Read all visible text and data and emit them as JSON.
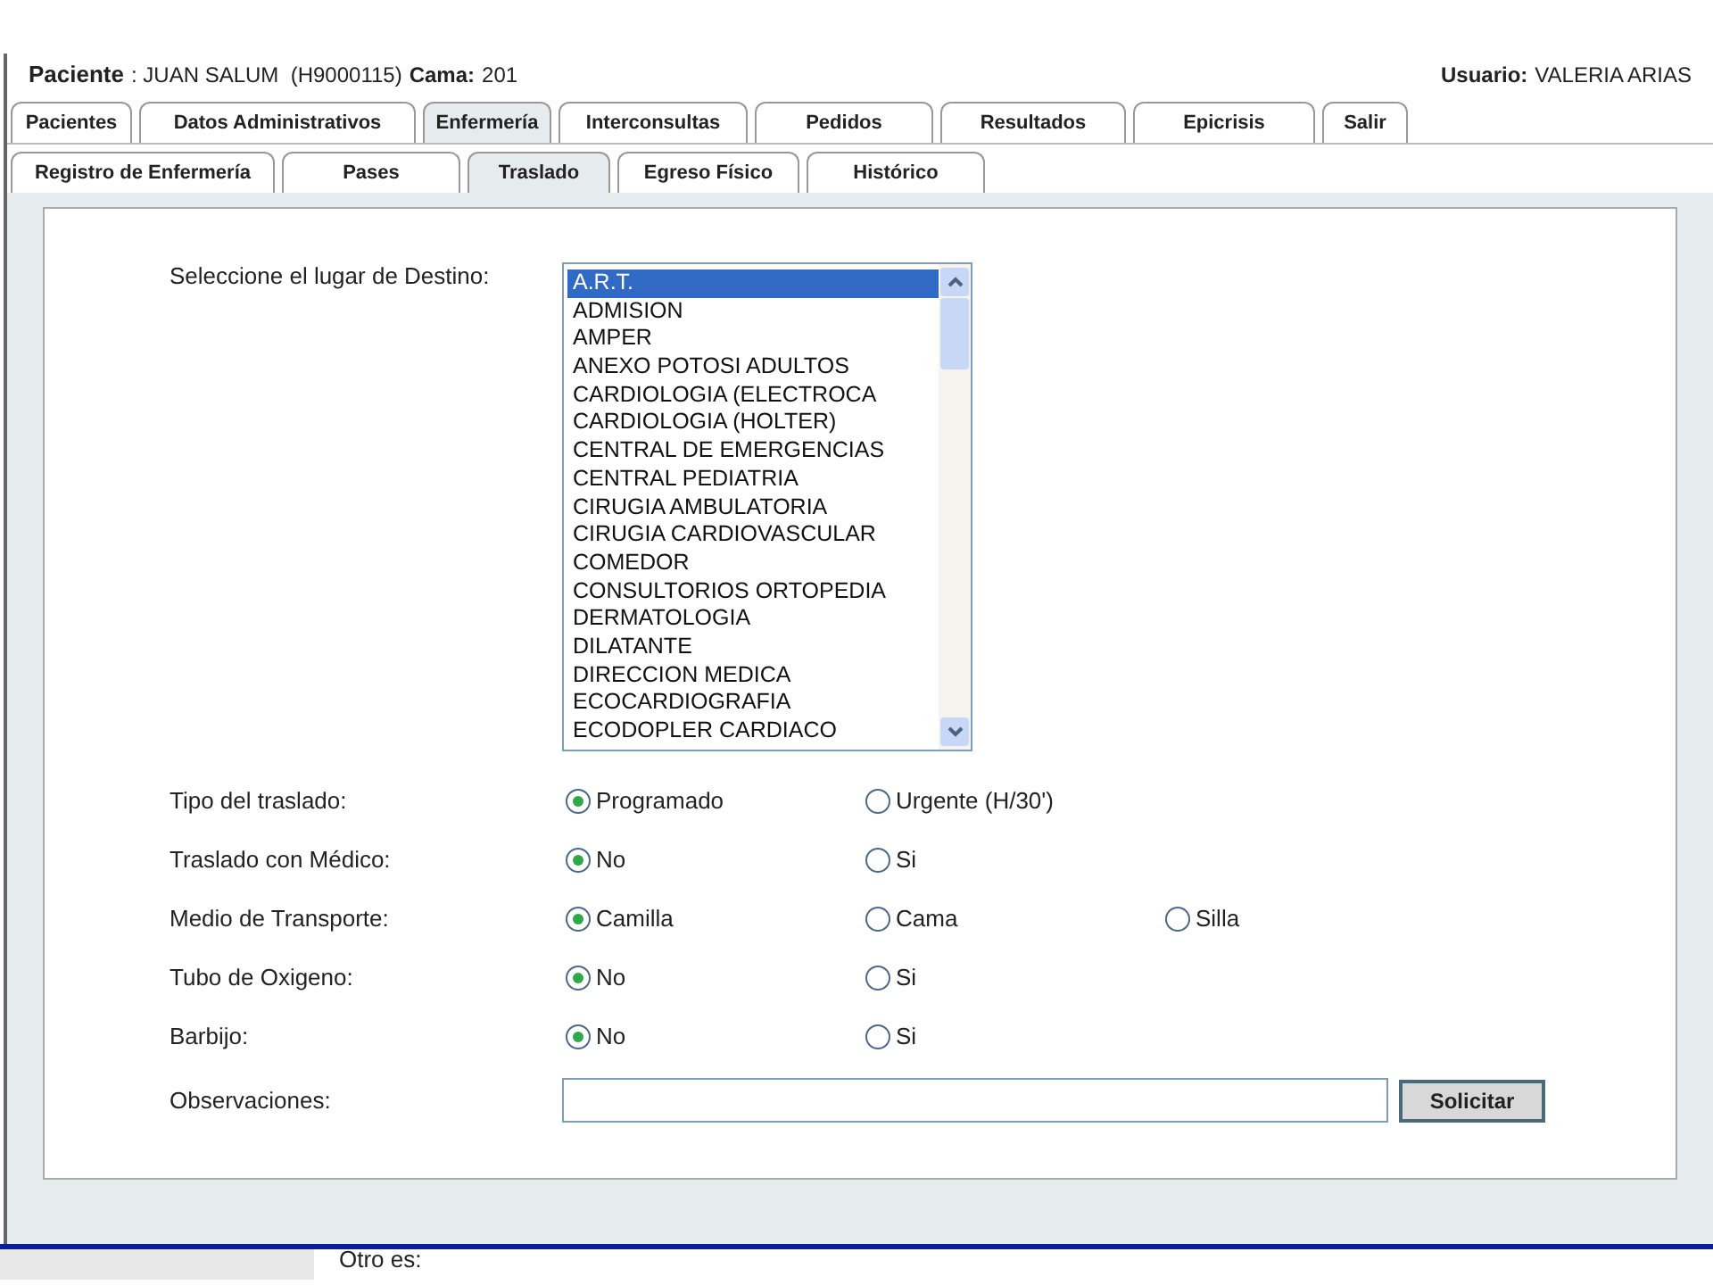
{
  "header": {
    "patient_label": "Paciente",
    "patient_value": ": JUAN SALUM  (H9000115)",
    "bed_label": "Cama:",
    "bed_value": "201",
    "user_label": "Usuario:",
    "user_value": "VALERIA ARIAS"
  },
  "main_tabs": [
    {
      "label": "Pacientes",
      "selected": false
    },
    {
      "label": "Datos Administrativos",
      "selected": false
    },
    {
      "label": "Enfermería",
      "selected": true
    },
    {
      "label": "Interconsultas",
      "selected": false
    },
    {
      "label": "Pedidos",
      "selected": false
    },
    {
      "label": "Resultados",
      "selected": false
    },
    {
      "label": "Epicrisis",
      "selected": false
    },
    {
      "label": "Salir",
      "selected": false
    }
  ],
  "sub_tabs": [
    {
      "label": "Registro de Enfermería",
      "selected": false
    },
    {
      "label": "Pases",
      "selected": false
    },
    {
      "label": "Traslado",
      "selected": true
    },
    {
      "label": "Egreso Físico",
      "selected": false
    },
    {
      "label": "Histórico",
      "selected": false
    }
  ],
  "destination": {
    "label": "Seleccione el lugar de Destino:",
    "options": [
      {
        "label": "A.R.T.",
        "selected": true
      },
      {
        "label": "ADMISION",
        "selected": false
      },
      {
        "label": "AMPER",
        "selected": false
      },
      {
        "label": "ANEXO POTOSI ADULTOS",
        "selected": false
      },
      {
        "label": "CARDIOLOGIA (ELECTROCA",
        "selected": false
      },
      {
        "label": "CARDIOLOGIA (HOLTER)",
        "selected": false
      },
      {
        "label": "CENTRAL DE EMERGENCIAS",
        "selected": false
      },
      {
        "label": "CENTRAL PEDIATRIA",
        "selected": false
      },
      {
        "label": "CIRUGIA AMBULATORIA",
        "selected": false
      },
      {
        "label": "CIRUGIA CARDIOVASCULAR",
        "selected": false
      },
      {
        "label": "COMEDOR",
        "selected": false
      },
      {
        "label": "CONSULTORIOS ORTOPEDIA",
        "selected": false
      },
      {
        "label": "DERMATOLOGIA",
        "selected": false
      },
      {
        "label": "DILATANTE",
        "selected": false
      },
      {
        "label": "DIRECCION MEDICA",
        "selected": false
      },
      {
        "label": "ECOCARDIOGRAFIA",
        "selected": false
      },
      {
        "label": "ECODOPLER CARDIACO",
        "selected": false
      }
    ]
  },
  "radio_groups": [
    {
      "label": "Tipo del traslado:",
      "options": [
        {
          "label": "Programado",
          "selected": true
        },
        {
          "label": "Urgente (H/30')",
          "selected": false
        }
      ]
    },
    {
      "label": "Traslado con Médico:",
      "options": [
        {
          "label": "No",
          "selected": true
        },
        {
          "label": "Si",
          "selected": false
        }
      ]
    },
    {
      "label": "Medio de Transporte:",
      "options": [
        {
          "label": "Camilla",
          "selected": true
        },
        {
          "label": "Cama",
          "selected": false
        },
        {
          "label": "Silla",
          "selected": false
        }
      ]
    },
    {
      "label": "Tubo de Oxigeno:",
      "options": [
        {
          "label": "No",
          "selected": true
        },
        {
          "label": "Si",
          "selected": false
        }
      ]
    },
    {
      "label": "Barbijo:",
      "options": [
        {
          "label": "No",
          "selected": true
        },
        {
          "label": "Si",
          "selected": false
        }
      ]
    }
  ],
  "observations": {
    "label": "Observaciones:",
    "button": "Solicitar"
  },
  "footer_text": "Otro es:"
}
